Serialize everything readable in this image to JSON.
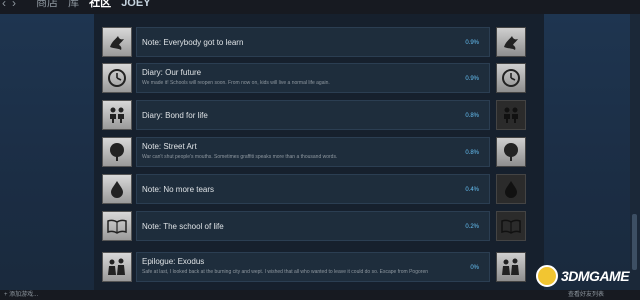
{
  "topbar": {
    "back_icon": "back-arrow-icon",
    "forward_icon": "forward-arrow-icon",
    "crumbs": [
      "商店",
      "库",
      "社区",
      "JOEY"
    ]
  },
  "achievements": [
    {
      "title": "Note: Everybody got to learn",
      "desc": "",
      "percent": "0.9%",
      "icon": "bird-icon"
    },
    {
      "title": "Diary: Our future",
      "desc": "We made it! Schools will reopen soon. From now on, kids will live a normal life again.",
      "percent": "0.9%",
      "icon": "clock-icon"
    },
    {
      "title": "Diary: Bond for life",
      "desc": "",
      "percent": "0.8%",
      "icon": "children-icon"
    },
    {
      "title": "Note: Street Art",
      "desc": "War can't shut people's mouths. Sometimes graffiti speaks more than a thousand words.",
      "percent": "0.8%",
      "icon": "tree-icon"
    },
    {
      "title": "Note: No more tears",
      "desc": "",
      "percent": "0.4%",
      "icon": "teardrop-icon"
    },
    {
      "title": "Note: The school of life",
      "desc": "",
      "percent": "0.2%",
      "icon": "book-icon"
    },
    {
      "title": "Epilogue: Exodus",
      "desc": "Safe at last, I looked back at the burning city and wept. I wished that all who wanted to leave it could do so. Escape from Pogoren",
      "percent": "0%",
      "icon": "family-icon"
    }
  ],
  "bottombar": {
    "add_game": "+ 添加游戏...",
    "friends": "查看好友列表"
  },
  "watermark": "3DMGAME"
}
